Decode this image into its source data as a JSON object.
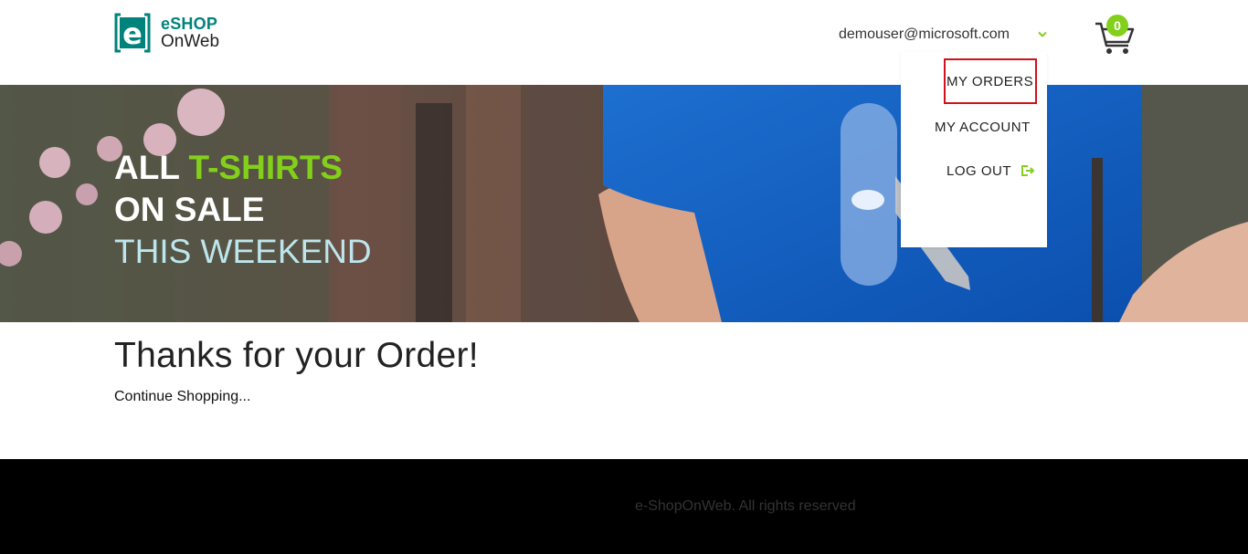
{
  "header": {
    "logo": {
      "line1": "eSHOP",
      "line2": "OnWeb",
      "icon": "e-logo-icon",
      "brand_color": "#00837a"
    },
    "user_email": "demouser@microsoft.com",
    "chevron_icon": "chevron-down-icon",
    "cart": {
      "icon": "cart-icon",
      "count": "0",
      "badge_color": "#83d01b"
    }
  },
  "hero": {
    "line1_part1": "ALL ",
    "line1_accent": "T-SHIRTS",
    "line2": "ON SALE",
    "line3": "THIS WEEKEND",
    "accent_color": "#83d01b"
  },
  "dropdown": {
    "items": [
      {
        "label": "MY ORDERS"
      },
      {
        "label": "MY ACCOUNT"
      },
      {
        "label": "LOG OUT"
      }
    ],
    "logout_icon": "logout-icon",
    "highlight_color": "#d0121c"
  },
  "main": {
    "title": "Thanks for your Order!",
    "continue_label": "Continue Shopping..."
  },
  "footer": {
    "text": "e-ShopOnWeb. All rights reserved"
  }
}
